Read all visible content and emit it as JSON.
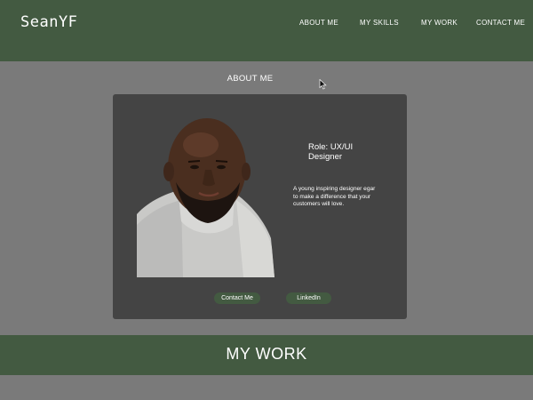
{
  "header": {
    "logo": "SeanYF",
    "nav": [
      {
        "label": "ABOUT ME"
      },
      {
        "label": "MY SKILLS"
      },
      {
        "label": "MY WORK"
      },
      {
        "label": "CONTACT ME"
      }
    ]
  },
  "about": {
    "title": "ABOUT ME",
    "card": {
      "role": "Role: UX/UI Designer",
      "bio": "A young inspiring designer egar to make a difference that your customers will love.",
      "buttons": {
        "contact": "Contact Me",
        "linkedin": "LinkedIn"
      }
    }
  },
  "work": {
    "title": "MY WORK"
  },
  "colors": {
    "brand_green": "#435a41",
    "page_bg": "#7a7a7a",
    "card_bg": "#444444",
    "text": "#ffffff"
  },
  "icons": {
    "cursor": "mouse-pointer-icon"
  }
}
